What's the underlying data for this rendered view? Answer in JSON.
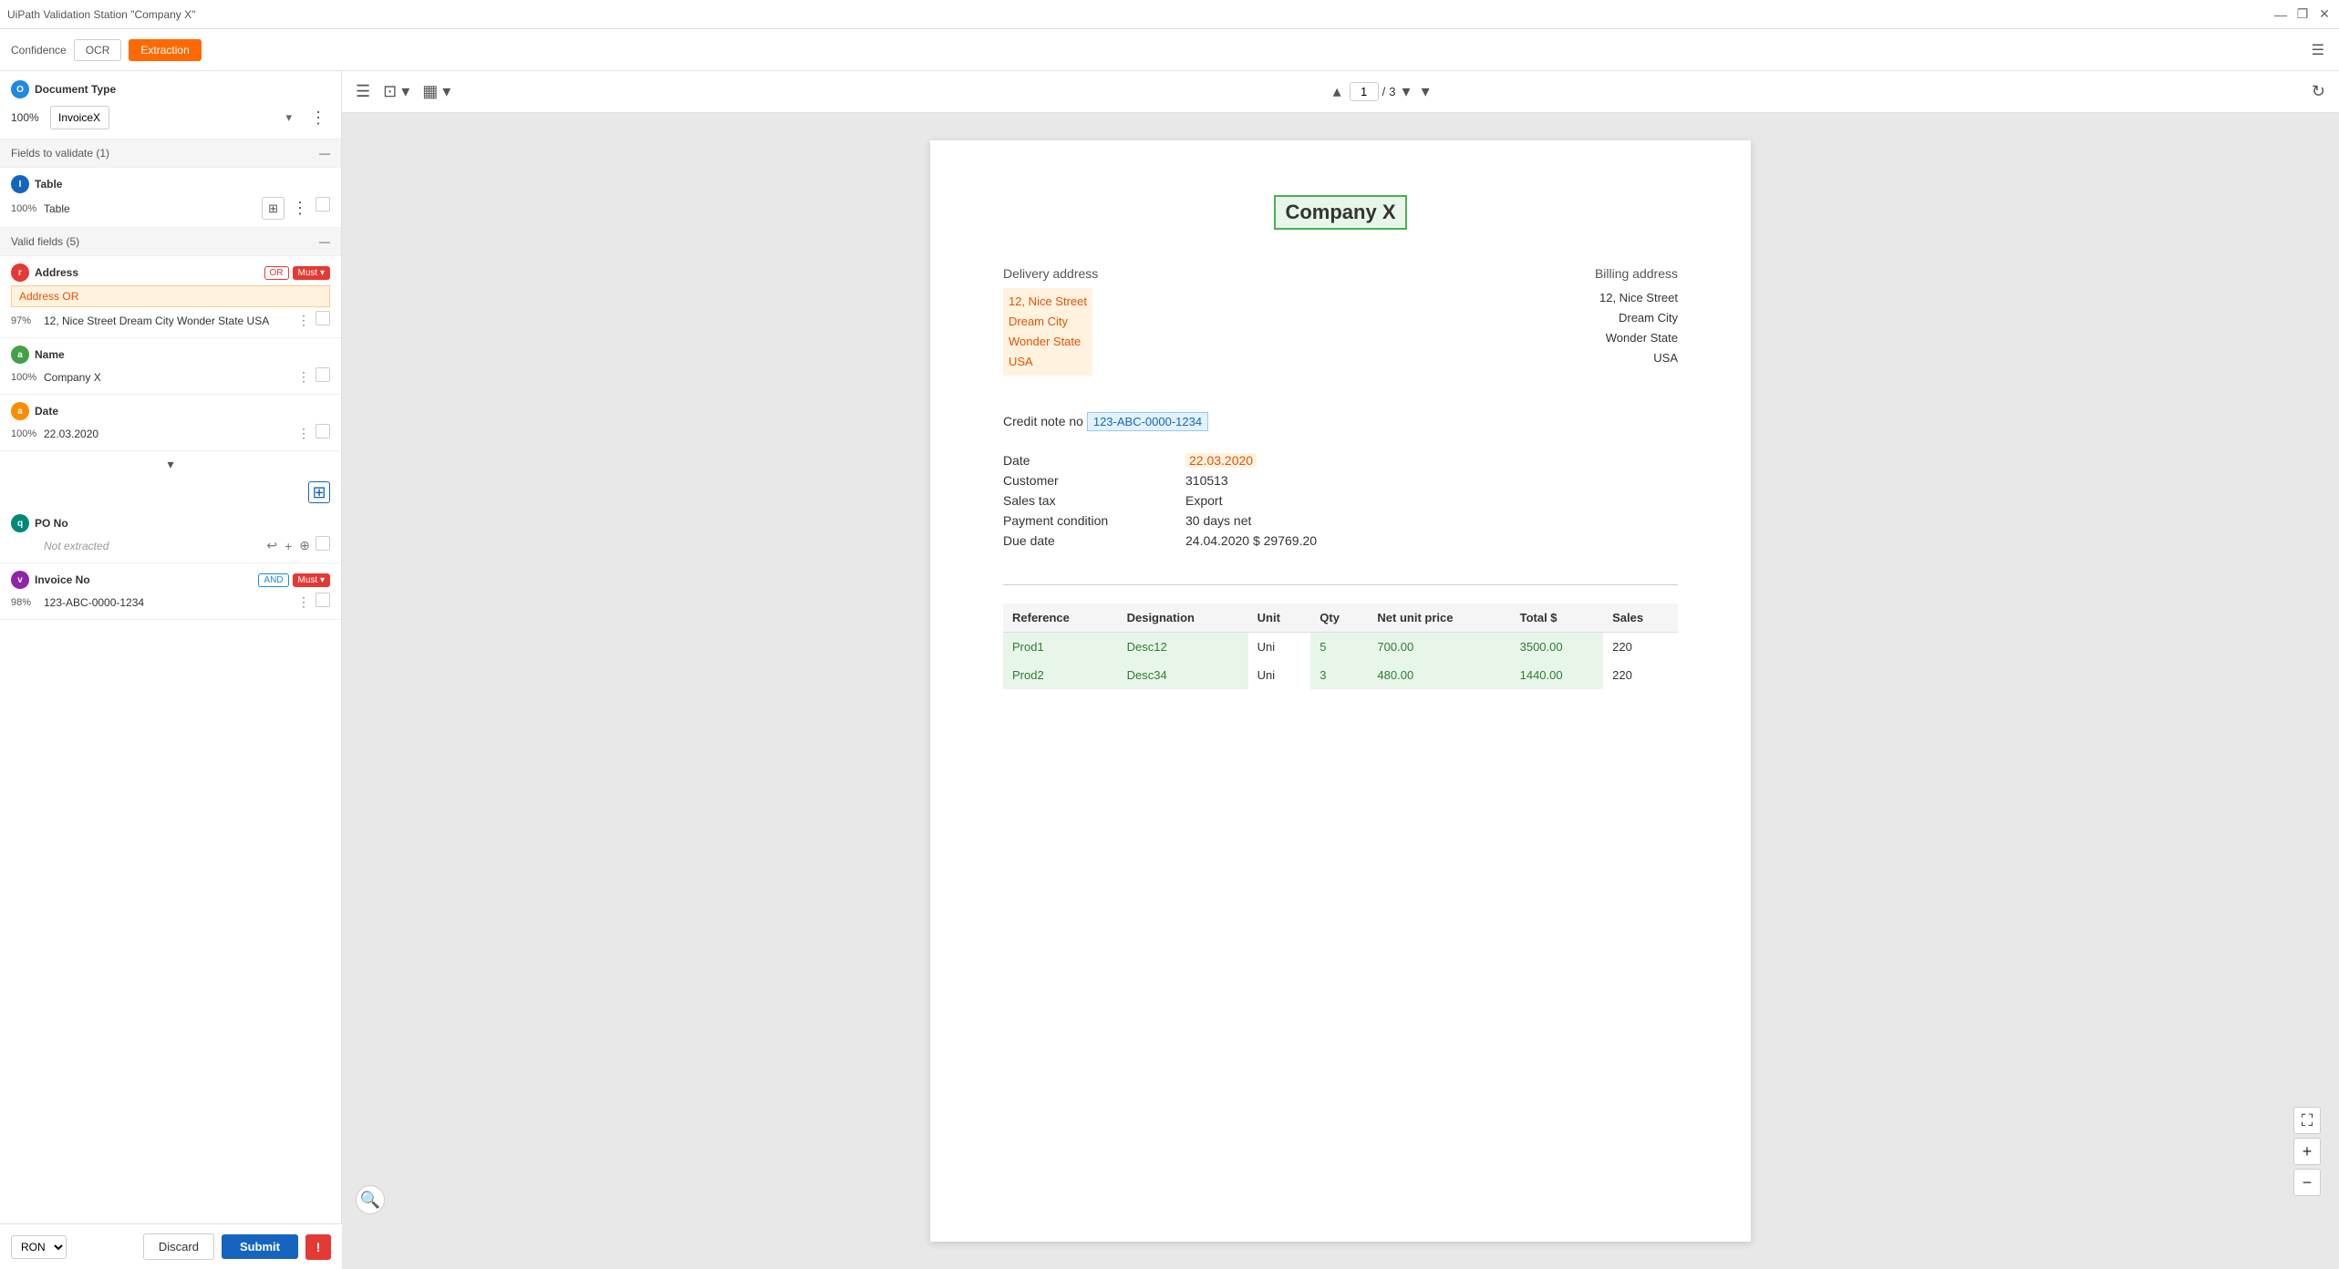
{
  "window": {
    "title": "UiPath Validation Station \"Company X\""
  },
  "toolbar": {
    "confidence_label": "Confidence",
    "ocr_label": "OCR",
    "extraction_label": "Extraction"
  },
  "left_panel": {
    "document_type": {
      "label": "Document Type",
      "confidence": "100%",
      "value": "InvoiceX"
    },
    "fields_to_validate": {
      "label": "Fields to validate (1)",
      "table_field": {
        "name": "Table",
        "confidence": "100%",
        "label": "Table"
      }
    },
    "valid_fields": {
      "label": "Valid fields (5)",
      "fields": [
        {
          "id": "address",
          "name": "Address",
          "confidence": "97%",
          "value": "12, Nice Street Dream City Wonder State USA",
          "tag1": "OR",
          "tag2": "Must",
          "badge_color": "red",
          "badge_letter": "r"
        },
        {
          "id": "name",
          "name": "Name",
          "confidence": "100%",
          "value": "Company X",
          "badge_color": "green",
          "badge_letter": "a"
        },
        {
          "id": "date",
          "name": "Date",
          "confidence": "100%",
          "value": "22.03.2020",
          "badge_color": "orange",
          "badge_letter": "a"
        },
        {
          "id": "po_no",
          "name": "PO No",
          "confidence": "",
          "value": "Not extracted",
          "badge_color": "teal",
          "badge_letter": "q"
        },
        {
          "id": "invoice_no",
          "name": "Invoice No",
          "confidence": "98%",
          "value": "123-ABC-0000-1234",
          "tag1": "AND",
          "tag2": "Must",
          "badge_color": "purple",
          "badge_letter": "v"
        }
      ]
    },
    "bottom": {
      "language": "RON",
      "discard": "Discard",
      "submit": "Submit"
    }
  },
  "viewer": {
    "page_current": "1",
    "page_total": "3",
    "document": {
      "company_name": "Company X",
      "delivery_address_label": "Delivery address",
      "billing_address_label": "Billing address",
      "delivery_address": {
        "line1": "12, Nice Street",
        "line2": "Dream City",
        "line3": "Wonder State",
        "line4": "USA"
      },
      "billing_address": {
        "line1": "12, Nice Street",
        "line2": "Dream City",
        "line3": "Wonder State",
        "line4": "USA"
      },
      "credit_note_label": "Credit note no",
      "credit_note_number": "123-ABC-0000-1234",
      "info_rows": [
        {
          "label": "Date",
          "value": "22.03.2020",
          "highlight": true
        },
        {
          "label": "Customer",
          "value": "310513",
          "highlight": false
        },
        {
          "label": "Sales tax",
          "value": "Export",
          "highlight": false
        },
        {
          "label": "Payment condition",
          "value": "30 days net",
          "highlight": false
        },
        {
          "label": "Due date",
          "value": "24.04.2020 $ 29769.20",
          "highlight": false
        }
      ],
      "table_headers": [
        "Reference",
        "Designation",
        "Unit",
        "Qty",
        "Net unit price",
        "Total $",
        "Sales"
      ],
      "table_rows": [
        {
          "ref": "Prod1",
          "des": "Desc12",
          "unit": "Uni",
          "qty": "5",
          "unit_price": "700.00",
          "total": "3500.00",
          "sales": "220"
        },
        {
          "ref": "Prod2",
          "des": "Desc34",
          "unit": "Uni",
          "qty": "3",
          "unit_price": "480.00",
          "total": "1440.00",
          "sales": "220"
        }
      ]
    }
  },
  "icons": {
    "filter": "☰",
    "grid": "⊞",
    "layout": "▦",
    "chevron_down": "▾",
    "chevron_up": "▴",
    "more_vert": "⋮",
    "close": "✕",
    "minimize": "—",
    "restore": "❐",
    "zoom_in": "+",
    "zoom_out": "−",
    "fullscreen": "⛶",
    "refresh": "↻",
    "undo": "↩",
    "add": "+",
    "add_circle": "⊕",
    "search": "🔍"
  }
}
